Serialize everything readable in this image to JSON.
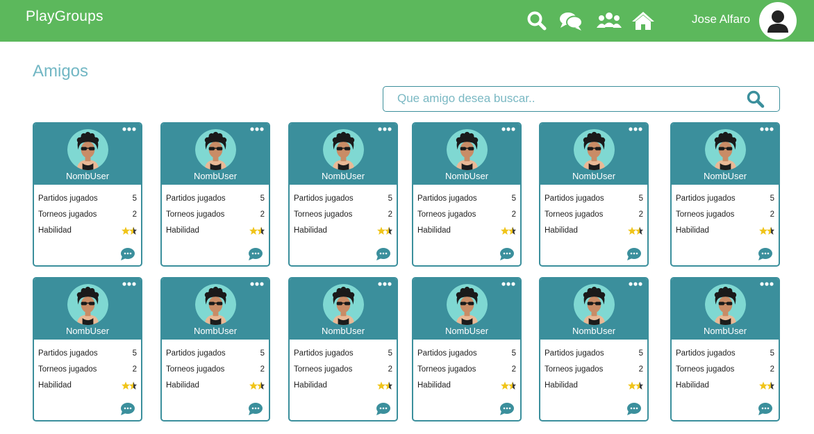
{
  "app": {
    "brand": "PlayGroups",
    "user_name": "Jose Alfaro"
  },
  "nav": {
    "icons": [
      "search-icon",
      "chat-icon",
      "group-icon",
      "home-icon"
    ]
  },
  "page": {
    "title": "Amigos"
  },
  "search": {
    "placeholder": "Que amigo desea buscar..",
    "value": ""
  },
  "colors": {
    "header": "#5cb85c",
    "accent": "#3b8f9c",
    "title": "#72b7c4",
    "star": "#f0c419"
  },
  "cards": [
    {
      "name": "NombUser",
      "stats": [
        {
          "label": "Partidos jugados",
          "value": "5"
        },
        {
          "label": "Torneos jugados",
          "value": "2"
        },
        {
          "label": "Habilidad",
          "rating": 1.5
        }
      ]
    },
    {
      "name": "NombUser",
      "stats": [
        {
          "label": "Partidos jugados",
          "value": "5"
        },
        {
          "label": "Torneos jugados",
          "value": "2"
        },
        {
          "label": "Habilidad",
          "rating": 1.5
        }
      ]
    },
    {
      "name": "NombUser",
      "stats": [
        {
          "label": "Partidos jugados",
          "value": "5"
        },
        {
          "label": "Torneos jugados",
          "value": "2"
        },
        {
          "label": "Habilidad",
          "rating": 1.5
        }
      ]
    },
    {
      "name": "NombUser",
      "stats": [
        {
          "label": "Partidos jugados",
          "value": "5"
        },
        {
          "label": "Torneos jugados",
          "value": "2"
        },
        {
          "label": "Habilidad",
          "rating": 1.5
        }
      ]
    },
    {
      "name": "NombUser",
      "stats": [
        {
          "label": "Partidos jugados",
          "value": "5"
        },
        {
          "label": "Torneos jugados",
          "value": "2"
        },
        {
          "label": "Habilidad",
          "rating": 1.5
        }
      ]
    },
    {
      "name": "NombUser",
      "stats": [
        {
          "label": "Partidos jugados",
          "value": "5"
        },
        {
          "label": "Torneos jugados",
          "value": "2"
        },
        {
          "label": "Habilidad",
          "rating": 1.5
        }
      ]
    },
    {
      "name": "NombUser",
      "stats": [
        {
          "label": "Partidos jugados",
          "value": "5"
        },
        {
          "label": "Torneos jugados",
          "value": "2"
        },
        {
          "label": "Habilidad",
          "rating": 1.5
        }
      ]
    },
    {
      "name": "NombUser",
      "stats": [
        {
          "label": "Partidos jugados",
          "value": "5"
        },
        {
          "label": "Torneos jugados",
          "value": "2"
        },
        {
          "label": "Habilidad",
          "rating": 1.5
        }
      ]
    },
    {
      "name": "NombUser",
      "stats": [
        {
          "label": "Partidos jugados",
          "value": "5"
        },
        {
          "label": "Torneos jugados",
          "value": "2"
        },
        {
          "label": "Habilidad",
          "rating": 1.5
        }
      ]
    },
    {
      "name": "NombUser",
      "stats": [
        {
          "label": "Partidos jugados",
          "value": "5"
        },
        {
          "label": "Torneos jugados",
          "value": "2"
        },
        {
          "label": "Habilidad",
          "rating": 1.5
        }
      ]
    },
    {
      "name": "NombUser",
      "stats": [
        {
          "label": "Partidos jugados",
          "value": "5"
        },
        {
          "label": "Torneos jugados",
          "value": "2"
        },
        {
          "label": "Habilidad",
          "rating": 1.5
        }
      ]
    },
    {
      "name": "NombUser",
      "stats": [
        {
          "label": "Partidos jugados",
          "value": "5"
        },
        {
          "label": "Torneos jugados",
          "value": "2"
        },
        {
          "label": "Habilidad",
          "rating": 1.5
        }
      ]
    }
  ]
}
